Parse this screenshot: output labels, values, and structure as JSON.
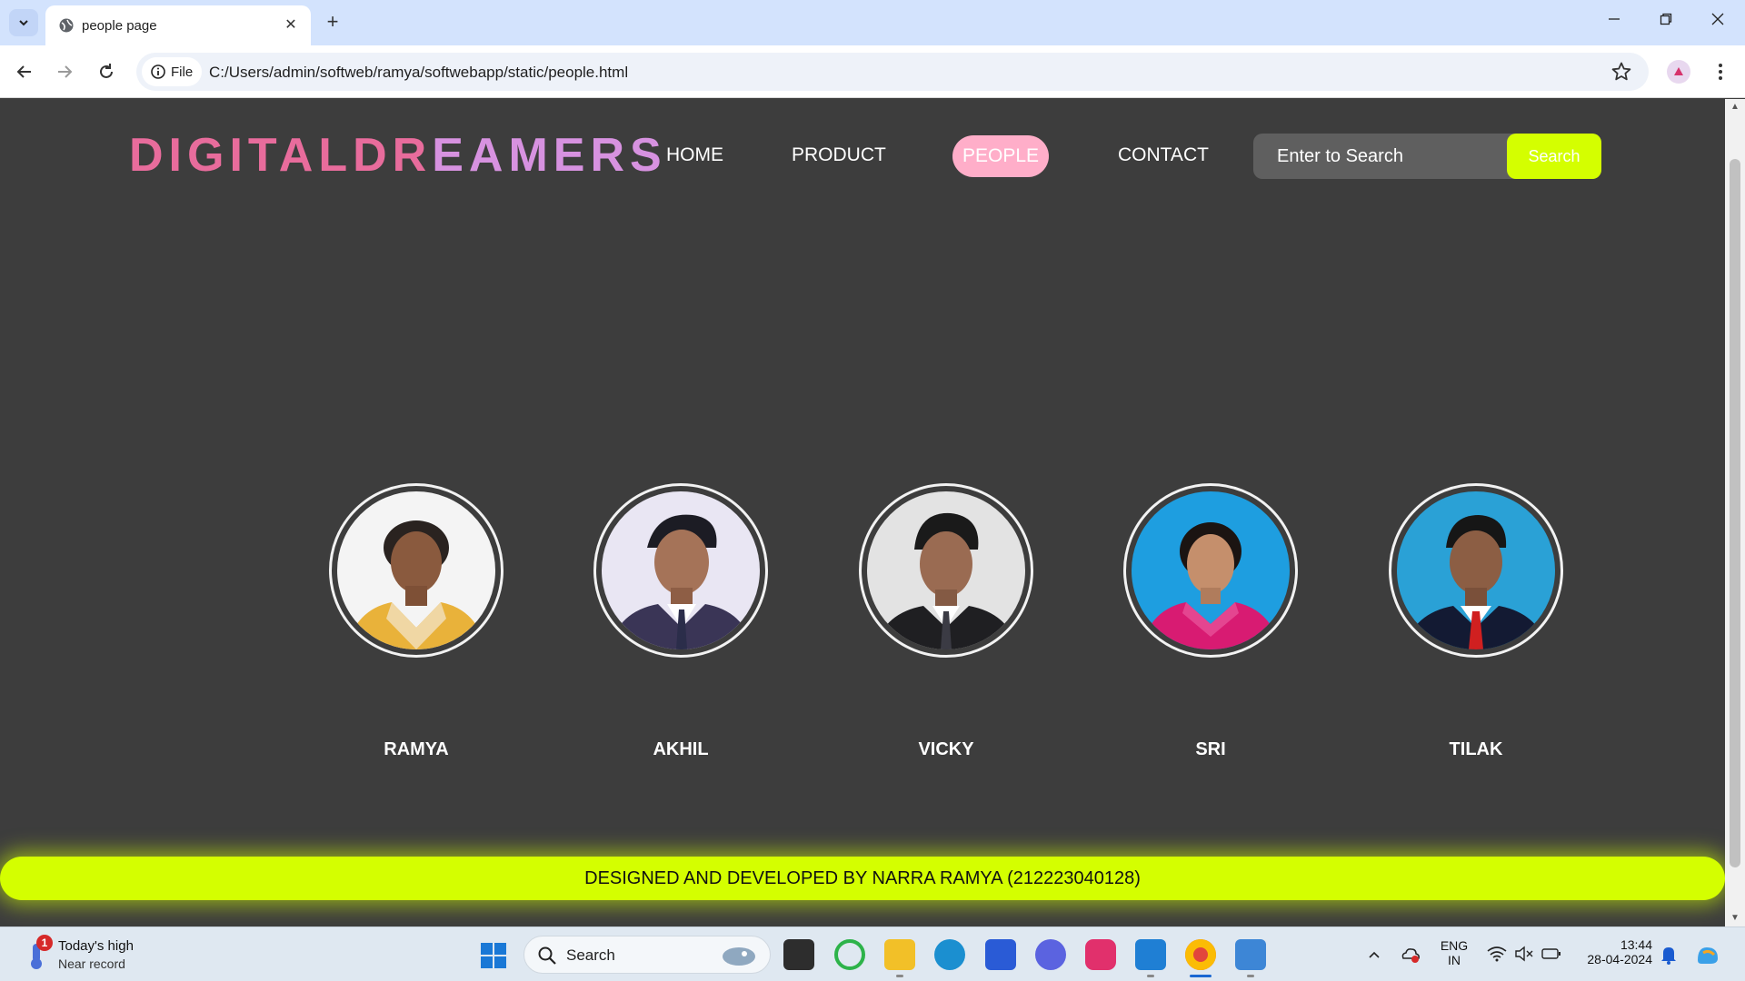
{
  "browser": {
    "tab_title": "people page",
    "close_label": "✕",
    "new_tab_label": "+",
    "file_chip": "File",
    "url": "C:/Users/admin/softweb/ramya/softwebapp/static/people.html"
  },
  "site": {
    "logo_parts": [
      "DIGITAL",
      "DR",
      "EAMERS"
    ],
    "nav": {
      "home": "HOME",
      "product": "PRODUCT",
      "people": "PEOPLE",
      "contact": "CONTACT"
    },
    "search": {
      "placeholder": "Enter to Search",
      "button": "Search"
    },
    "people": [
      {
        "name": "RAMYA"
      },
      {
        "name": "AKHIL"
      },
      {
        "name": "VICKY"
      },
      {
        "name": "SRI"
      },
      {
        "name": "TILAK"
      }
    ],
    "footer": "DESIGNED AND DEVELOPED BY NARRA RAMYA (212223040128)"
  },
  "taskbar": {
    "weather_title": "Today's high",
    "weather_sub": "Near record",
    "weather_badge": "1",
    "search_label": "Search",
    "lang_line1": "ENG",
    "lang_line2": "IN",
    "time": "13:44",
    "date": "28-04-2024"
  },
  "colors": {
    "page_bg": "#3d3d3d",
    "accent_lime": "#d4ff00",
    "active_pink": "#ffaec9",
    "logo_pink": "#e86c9c",
    "logo_violet": "#d792e0"
  }
}
